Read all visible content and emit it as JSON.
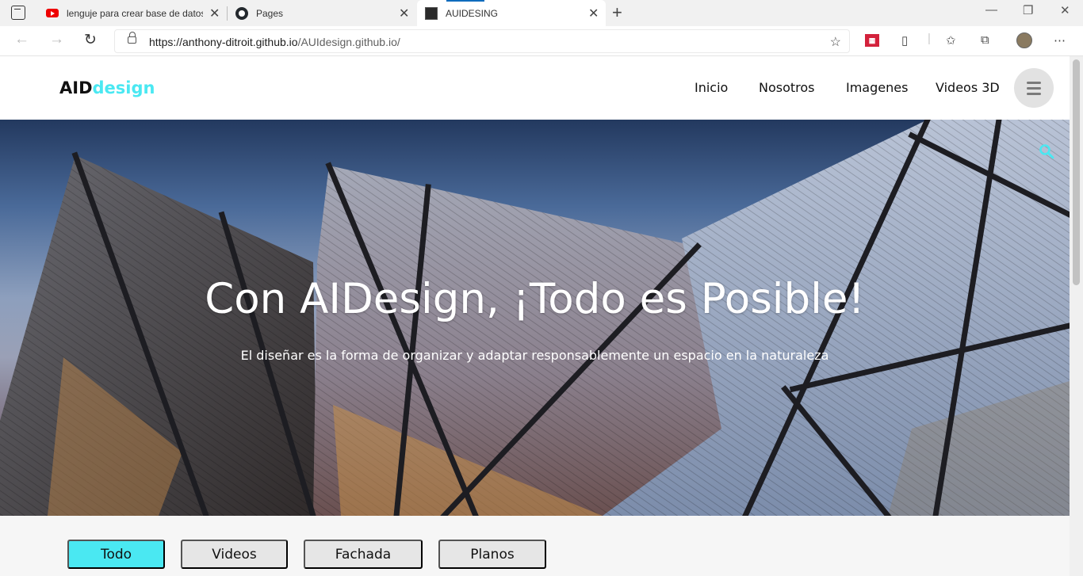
{
  "browser": {
    "tabs": [
      {
        "title": "lenguje para crear base de datos",
        "favicon": "youtube-icon"
      },
      {
        "title": "Pages",
        "favicon": "github-icon"
      },
      {
        "title": "AUIDESING",
        "favicon": "site-icon"
      }
    ],
    "url_host": "https://anthony-ditroit.github.io",
    "url_path": "/AUIdesign.github.io/"
  },
  "site": {
    "logo": {
      "bold": "AID",
      "accent": "design"
    },
    "nav": [
      "Inicio",
      "Nosotros",
      "Imagenes",
      "Videos 3D"
    ],
    "hero": {
      "title": "Con AIDesign, ¡Todo es Posible!",
      "subtitle": "El diseñar es la forma de organizar y adaptar responsablemente un espacio en la naturaleza"
    },
    "filters": [
      "Todo",
      "Videos",
      "Fachada",
      "Planos"
    ],
    "active_filter": "Todo"
  },
  "colors": {
    "accent": "#4ae8f2",
    "browser_active_tab_line": "#0f6cbd"
  }
}
